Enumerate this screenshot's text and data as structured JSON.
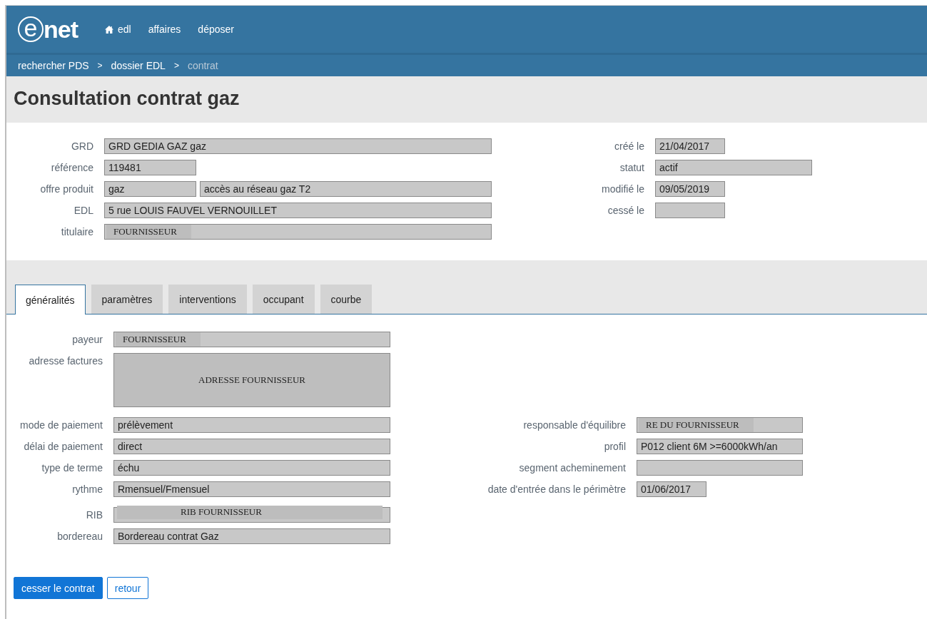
{
  "header": {
    "logo": {
      "circled": "e",
      "text": "net"
    },
    "nav": [
      {
        "label": "edl",
        "kind": "home"
      },
      {
        "label": "affaires",
        "kind": "plain"
      },
      {
        "label": "déposer",
        "kind": "plain"
      }
    ]
  },
  "breadcrumb": [
    {
      "label": "rechercher PDS",
      "current": false
    },
    {
      "label": "dossier EDL",
      "current": false
    },
    {
      "label": "contrat",
      "current": true
    }
  ],
  "breadcrumb_separator": ">",
  "title": "Consultation contrat gaz",
  "summary": {
    "left": [
      {
        "label": "GRD",
        "values": [
          {
            "text": "GRD GEDIA GAZ gaz",
            "kind": "plain"
          }
        ]
      },
      {
        "label": "référence",
        "values": [
          {
            "text": "119481",
            "kind": "plain"
          }
        ]
      },
      {
        "label": "offre produit",
        "values": [
          {
            "text": "gaz",
            "kind": "plain"
          },
          {
            "text": "accès au réseau gaz T2",
            "kind": "plain"
          }
        ]
      },
      {
        "label": "EDL",
        "values": [
          {
            "text": "5 rue LOUIS FAUVEL VERNOUILLET",
            "kind": "plain"
          }
        ]
      },
      {
        "label": "titulaire",
        "values": [
          {
            "text": "FOURNISSEUR",
            "kind": "overlay"
          }
        ]
      }
    ],
    "right": [
      {
        "label": "créé le",
        "values": [
          {
            "text": "21/04/2017",
            "kind": "plain"
          }
        ]
      },
      {
        "label": "statut",
        "values": [
          {
            "text": "actif",
            "kind": "plain"
          }
        ]
      },
      {
        "label": "modifié le",
        "values": [
          {
            "text": "09/05/2019",
            "kind": "plain"
          }
        ]
      },
      {
        "label": "cessé le",
        "values": [
          {
            "kind": "plain"
          }
        ]
      }
    ]
  },
  "tabs": [
    {
      "label": "généralités",
      "selected": true
    },
    {
      "label": "paramètres",
      "selected": false
    },
    {
      "label": "interventions",
      "selected": false
    },
    {
      "label": "occupant",
      "selected": false
    },
    {
      "label": "courbe",
      "selected": false
    }
  ],
  "details": {
    "top": [
      {
        "label": "payeur",
        "values": [
          {
            "text": "FOURNISSEUR",
            "kind": "overlay"
          }
        ]
      },
      {
        "label": "adresse factures",
        "values": [
          {
            "text": "ADRESSE FOURNISSEUR",
            "kind": "area"
          }
        ]
      }
    ],
    "left": [
      {
        "label": "mode de paiement",
        "values": [
          {
            "text": "prélèvement",
            "kind": "plain"
          }
        ]
      },
      {
        "label": "délai de paiement",
        "values": [
          {
            "text": "direct",
            "kind": "plain"
          }
        ]
      },
      {
        "label": "type de terme",
        "values": [
          {
            "text": "échu",
            "kind": "plain"
          }
        ]
      },
      {
        "label": "rythme",
        "values": [
          {
            "text": "Rmensuel/Fmensuel",
            "kind": "plain"
          }
        ]
      },
      {
        "label": "RIB",
        "values": [
          {
            "text": "RIB FOURNISSEUR",
            "kind": "banner"
          }
        ]
      },
      {
        "label": "bordereau",
        "values": [
          {
            "text": "Bordereau contrat Gaz",
            "kind": "plain"
          }
        ]
      }
    ],
    "right": [
      {
        "label": "responsable d'équilibre",
        "values": [
          {
            "text": "RE DU FOURNISSEUR",
            "kind": "overlay"
          }
        ]
      },
      {
        "label": "profil",
        "values": [
          {
            "text": "P012 client 6M >=6000kWh/an",
            "kind": "plain"
          }
        ]
      },
      {
        "label": "segment acheminement",
        "values": [
          {
            "kind": "plain"
          }
        ]
      },
      {
        "label": "date d'entrée dans le périmètre",
        "values": [
          {
            "text": "01/06/2017",
            "kind": "plain"
          }
        ]
      }
    ]
  },
  "buttons": [
    {
      "label": "cesser le contrat",
      "kind": "primary"
    },
    {
      "label": "retour",
      "kind": "secondary"
    }
  ]
}
